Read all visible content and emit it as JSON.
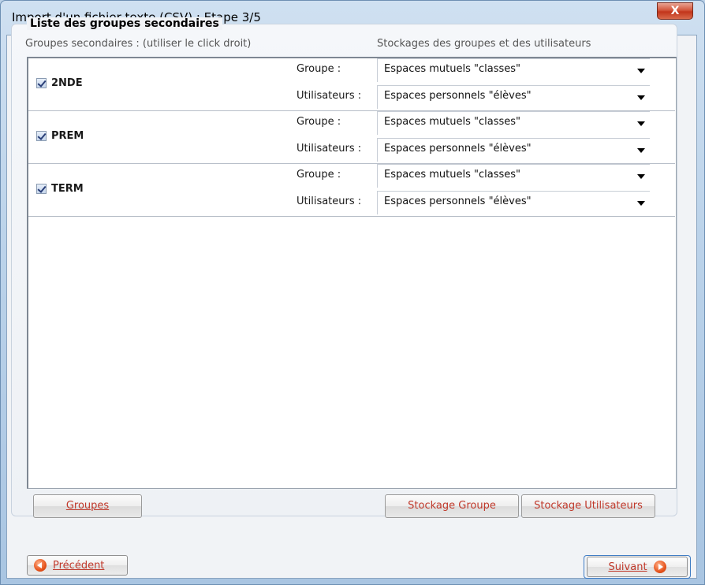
{
  "window": {
    "title": "Import d'un fichier texte (CSV) : Etape 3/5",
    "close_label": "X"
  },
  "group_box": {
    "title": "Liste des groupes secondaires",
    "left_header": "Groupes secondaires : (utiliser le click droit)",
    "right_header": "Stockages des groupes et des utilisateurs"
  },
  "groups": [
    {
      "name": "2NDE",
      "checked": true,
      "group_label": "Groupe :",
      "group_value": "Espaces mutuels \"classes\"",
      "users_label": "Utilisateurs :",
      "users_value": "Espaces personnels \"élèves\""
    },
    {
      "name": "PREM",
      "checked": true,
      "group_label": "Groupe :",
      "group_value": "Espaces mutuels \"classes\"",
      "users_label": "Utilisateurs :",
      "users_value": "Espaces personnels \"élèves\""
    },
    {
      "name": "TERM",
      "checked": true,
      "group_label": "Groupe :",
      "group_value": "Espaces mutuels \"classes\"",
      "users_label": "Utilisateurs :",
      "users_value": "Espaces personnels \"élèves\""
    }
  ],
  "buttons": {
    "groupes": "Groupes",
    "stockage_groupe": "Stockage Groupe",
    "stockage_utilisateurs": "Stockage Utilisateurs",
    "precedent": "Précédent",
    "suivant": "Suivant"
  },
  "colors": {
    "accent_text": "#c0392b",
    "close_button": "#c2351b"
  }
}
